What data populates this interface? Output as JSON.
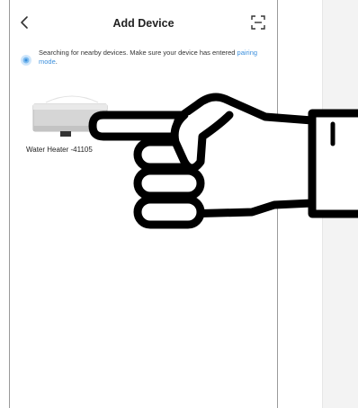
{
  "header": {
    "title": "Add Device",
    "back_icon": "chevron-left-icon",
    "scan_icon": "scan-icon"
  },
  "status": {
    "message": "Searching for nearby devices. Make sure your device has entered",
    "link_text": "pairing mode",
    "suffix": ".",
    "icon": "search-radar-icon",
    "link_color": "#3b8fdc"
  },
  "devices": [
    {
      "name": "Water Heater -41105"
    }
  ],
  "illustration": {
    "icon": "pointing-hand-icon"
  }
}
